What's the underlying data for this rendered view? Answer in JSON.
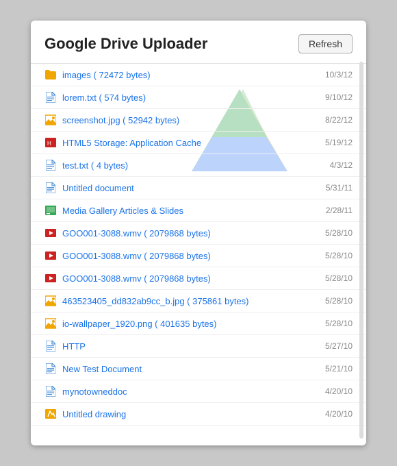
{
  "header": {
    "title": "Google Drive Uploader",
    "refresh_label": "Refresh"
  },
  "files": [
    {
      "id": "images",
      "name": "images ( 72472 bytes)",
      "date": "10/3/12",
      "icon_type": "folder",
      "icon_symbol": "📁"
    },
    {
      "id": "lorem-txt",
      "name": "lorem.txt ( 574 bytes)",
      "date": "9/10/12",
      "icon_type": "txt",
      "icon_symbol": "📄"
    },
    {
      "id": "screenshot-jpg",
      "name": "screenshot.jpg ( 52942 bytes)",
      "date": "8/22/12",
      "icon_type": "img",
      "icon_symbol": "🖼"
    },
    {
      "id": "html5-storage",
      "name": "HTML5 Storage: Application Cache",
      "date": "5/19/12",
      "icon_type": "html",
      "icon_symbol": "📄"
    },
    {
      "id": "test-txt",
      "name": "test.txt ( 4 bytes)",
      "date": "4/3/12",
      "icon_type": "txt",
      "icon_symbol": "📄"
    },
    {
      "id": "untitled-doc",
      "name": "Untitled document",
      "date": "5/31/11",
      "icon_type": "doc",
      "icon_symbol": "📄"
    },
    {
      "id": "media-gallery",
      "name": "Media Gallery Articles & Slides",
      "date": "2/28/11",
      "icon_type": "slides",
      "icon_symbol": "📊"
    },
    {
      "id": "goo001-1",
      "name": "GOO001-3088.wmv ( 2079868 bytes)",
      "date": "5/28/10",
      "icon_type": "video",
      "icon_symbol": "🎬"
    },
    {
      "id": "goo001-2",
      "name": "GOO001-3088.wmv ( 2079868 bytes)",
      "date": "5/28/10",
      "icon_type": "video",
      "icon_symbol": "🎬"
    },
    {
      "id": "goo001-3",
      "name": "GOO001-3088.wmv ( 2079868 bytes)",
      "date": "5/28/10",
      "icon_type": "video",
      "icon_symbol": "🎬"
    },
    {
      "id": "463523405",
      "name": "463523405_dd832ab9cc_b.jpg ( 375861 bytes)",
      "date": "5/28/10",
      "icon_type": "img",
      "icon_symbol": "🖼"
    },
    {
      "id": "io-wallpaper",
      "name": "io-wallpaper_1920.png ( 401635 bytes)",
      "date": "5/28/10",
      "icon_type": "img",
      "icon_symbol": "🖼"
    },
    {
      "id": "http",
      "name": "HTTP",
      "date": "5/27/10",
      "icon_type": "doc",
      "icon_symbol": "📄"
    },
    {
      "id": "new-test-doc",
      "name": "New Test Document",
      "date": "5/21/10",
      "icon_type": "doc",
      "icon_symbol": "📄"
    },
    {
      "id": "mynotowneddoc",
      "name": "mynotowneddoc",
      "date": "4/20/10",
      "icon_type": "doc",
      "icon_symbol": "📄"
    },
    {
      "id": "untitled-drawing",
      "name": "Untitled drawing",
      "date": "4/20/10",
      "icon_type": "drawing",
      "icon_symbol": "🎨"
    }
  ]
}
